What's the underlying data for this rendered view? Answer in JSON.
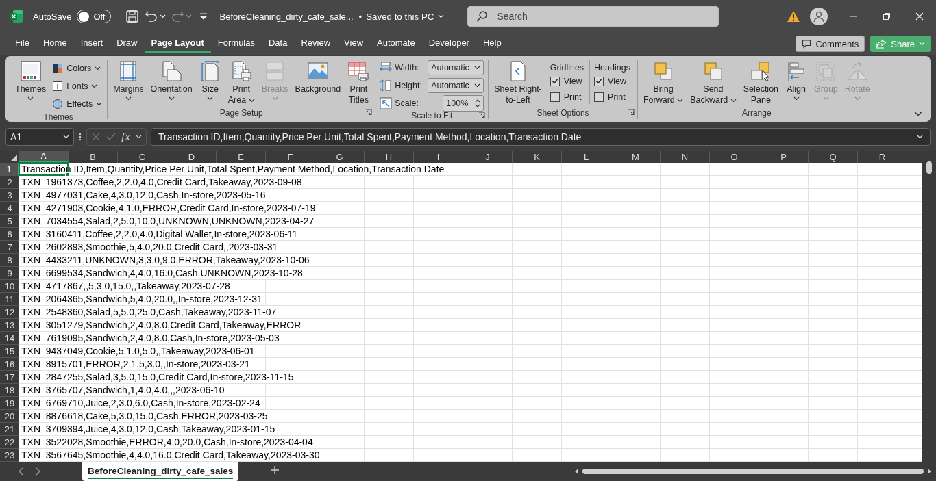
{
  "title_bar": {
    "quick_access": [
      {
        "kind": "save",
        "disabled": false
      },
      {
        "kind": "undo",
        "disabled": false
      },
      {
        "kind": "redo",
        "disabled": true
      },
      {
        "kind": "customize",
        "disabled": false
      }
    ],
    "autosave": {
      "label": "AutoSave",
      "on": false,
      "state_text": "Off"
    },
    "file_name": "BeforeCleaning_dirty_cafe_sale...",
    "separator": "•",
    "save_status": "Saved to this PC",
    "search": {
      "placeholder": "Search"
    }
  },
  "menu_tabs": [
    {
      "label": "File",
      "selected": false
    },
    {
      "label": "Home",
      "selected": false
    },
    {
      "label": "Insert",
      "selected": false
    },
    {
      "label": "Draw",
      "selected": false
    },
    {
      "label": "Page Layout",
      "selected": true
    },
    {
      "label": "Formulas",
      "selected": false
    },
    {
      "label": "Data",
      "selected": false
    },
    {
      "label": "Review",
      "selected": false
    },
    {
      "label": "View",
      "selected": false
    },
    {
      "label": "Automate",
      "selected": false
    },
    {
      "label": "Developer",
      "selected": false
    },
    {
      "label": "Help",
      "selected": false
    }
  ],
  "actions": [
    {
      "kind": "comments",
      "label": "Comments"
    },
    {
      "kind": "share",
      "label": "Share"
    }
  ],
  "ribbon": {
    "groups": [
      {
        "label": "Themes",
        "launcher": false,
        "items": [
          {
            "kind": "large",
            "lines": [
              "Themes"
            ],
            "dropdown": true,
            "disabled": false
          },
          {
            "kind": "stack",
            "items": [
              {
                "label": "Colors",
                "dropdown": true
              },
              {
                "label": "Fonts",
                "dropdown": true
              },
              {
                "label": "Effects",
                "dropdown": true
              }
            ]
          }
        ]
      },
      {
        "label": "Page Setup",
        "launcher": true,
        "items": [
          {
            "kind": "large",
            "lines": [
              "Margins"
            ],
            "dropdown": true,
            "disabled": false
          },
          {
            "kind": "large",
            "lines": [
              "Orientation"
            ],
            "dropdown": true,
            "disabled": false
          },
          {
            "kind": "large",
            "lines": [
              "Size"
            ],
            "dropdown": true,
            "disabled": false
          },
          {
            "kind": "large",
            "lines": [
              "Print",
              "Area"
            ],
            "dropdown": true,
            "disabled": false
          },
          {
            "kind": "large",
            "lines": [
              "Breaks"
            ],
            "dropdown": true,
            "disabled": true
          },
          {
            "kind": "large",
            "lines": [
              "Background"
            ],
            "dropdown": false,
            "disabled": false
          },
          {
            "kind": "large",
            "lines": [
              "Print",
              "Titles"
            ],
            "dropdown": false,
            "disabled": false
          }
        ]
      },
      {
        "label": "Scale to Fit",
        "launcher": true,
        "items": [
          {
            "kind": "fields",
            "items": [
              {
                "kind": "dropdown",
                "label": "Width:",
                "value": "Automatic"
              },
              {
                "kind": "dropdown",
                "label": "Height:",
                "value": "Automatic"
              },
              {
                "kind": "spinner",
                "label": "Scale:",
                "value": "100%"
              }
            ]
          }
        ]
      },
      {
        "label": "Sheet Options",
        "launcher": true,
        "items": [
          {
            "kind": "large",
            "lines": [
              "Sheet Right-",
              "to-Left"
            ],
            "dropdown": false,
            "disabled": false
          },
          {
            "kind": "checkgroup",
            "heading": "Gridlines",
            "items": [
              {
                "label": "View",
                "checked": true
              },
              {
                "label": "Print",
                "checked": false
              }
            ]
          },
          {
            "kind": "checkgroup",
            "heading": "Headings",
            "items": [
              {
                "label": "View",
                "checked": true
              },
              {
                "label": "Print",
                "checked": false
              }
            ]
          }
        ]
      },
      {
        "label": "Arrange",
        "launcher": false,
        "items": [
          {
            "kind": "large",
            "lines": [
              "Bring",
              "Forward"
            ],
            "dropdown": true,
            "disabled": false
          },
          {
            "kind": "large",
            "lines": [
              "Send",
              "Backward"
            ],
            "dropdown": true,
            "disabled": false
          },
          {
            "kind": "large",
            "lines": [
              "Selection",
              "Pane"
            ],
            "dropdown": false,
            "disabled": false
          },
          {
            "kind": "large",
            "lines": [
              "Align"
            ],
            "dropdown": true,
            "disabled": false
          },
          {
            "kind": "large",
            "lines": [
              "Group"
            ],
            "dropdown": true,
            "disabled": true
          },
          {
            "kind": "large",
            "lines": [
              "Rotate"
            ],
            "dropdown": true,
            "disabled": true
          }
        ]
      }
    ]
  },
  "formula_bar": {
    "name_box": "A1",
    "fx": "fx",
    "content": "Transaction ID,Item,Quantity,Price Per Unit,Total Spent,Payment Method,Location,Transaction Date"
  },
  "sheet": {
    "columns": [
      {
        "label": "A",
        "selected": true
      },
      {
        "label": "B",
        "selected": false
      },
      {
        "label": "C",
        "selected": false
      },
      {
        "label": "D",
        "selected": false
      },
      {
        "label": "E",
        "selected": false
      },
      {
        "label": "F",
        "selected": false
      },
      {
        "label": "G",
        "selected": false
      },
      {
        "label": "H",
        "selected": false
      },
      {
        "label": "I",
        "selected": false
      },
      {
        "label": "J",
        "selected": false
      },
      {
        "label": "K",
        "selected": false
      },
      {
        "label": "L",
        "selected": false
      },
      {
        "label": "M",
        "selected": false
      },
      {
        "label": "N",
        "selected": false
      },
      {
        "label": "O",
        "selected": false
      },
      {
        "label": "P",
        "selected": false
      },
      {
        "label": "Q",
        "selected": false
      },
      {
        "label": "R",
        "selected": false
      }
    ],
    "rows": [
      {
        "number": "1",
        "text": "Transaction ID,Item,Quantity,Price Per Unit,Total Spent,Payment Method,Location,Transaction Date",
        "selected": true
      },
      {
        "number": "2",
        "text": "TXN_1961373,Coffee,2,2.0,4.0,Credit Card,Takeaway,2023-09-08",
        "selected": false
      },
      {
        "number": "3",
        "text": "TXN_4977031,Cake,4,3.0,12.0,Cash,In-store,2023-05-16",
        "selected": false
      },
      {
        "number": "4",
        "text": "TXN_4271903,Cookie,4,1.0,ERROR,Credit Card,In-store,2023-07-19",
        "selected": false
      },
      {
        "number": "5",
        "text": "TXN_7034554,Salad,2,5.0,10.0,UNKNOWN,UNKNOWN,2023-04-27",
        "selected": false
      },
      {
        "number": "6",
        "text": "TXN_3160411,Coffee,2,2.0,4.0,Digital Wallet,In-store,2023-06-11",
        "selected": false
      },
      {
        "number": "7",
        "text": "TXN_2602893,Smoothie,5,4.0,20.0,Credit Card,,2023-03-31",
        "selected": false
      },
      {
        "number": "8",
        "text": "TXN_4433211,UNKNOWN,3,3.0,9.0,ERROR,Takeaway,2023-10-06",
        "selected": false
      },
      {
        "number": "9",
        "text": "TXN_6699534,Sandwich,4,4.0,16.0,Cash,UNKNOWN,2023-10-28",
        "selected": false
      },
      {
        "number": "10",
        "text": "TXN_4717867,,5,3.0,15.0,,Takeaway,2023-07-28",
        "selected": false
      },
      {
        "number": "11",
        "text": "TXN_2064365,Sandwich,5,4.0,20.0,,In-store,2023-12-31",
        "selected": false
      },
      {
        "number": "12",
        "text": "TXN_2548360,Salad,5,5.0,25.0,Cash,Takeaway,2023-11-07",
        "selected": false
      },
      {
        "number": "13",
        "text": "TXN_3051279,Sandwich,2,4.0,8.0,Credit Card,Takeaway,ERROR",
        "selected": false
      },
      {
        "number": "14",
        "text": "TXN_7619095,Sandwich,2,4.0,8.0,Cash,In-store,2023-05-03",
        "selected": false
      },
      {
        "number": "15",
        "text": "TXN_9437049,Cookie,5,1.0,5.0,,Takeaway,2023-06-01",
        "selected": false
      },
      {
        "number": "16",
        "text": "TXN_8915701,ERROR,2,1.5,3.0,,In-store,2023-03-21",
        "selected": false
      },
      {
        "number": "17",
        "text": "TXN_2847255,Salad,3,5.0,15.0,Credit Card,In-store,2023-11-15",
        "selected": false
      },
      {
        "number": "18",
        "text": "TXN_3765707,Sandwich,1,4.0,4.0,,,2023-06-10",
        "selected": false
      },
      {
        "number": "19",
        "text": "TXN_6769710,Juice,2,3.0,6.0,Cash,In-store,2023-02-24",
        "selected": false
      },
      {
        "number": "20",
        "text": "TXN_8876618,Cake,5,3.0,15.0,Cash,ERROR,2023-03-25",
        "selected": false
      },
      {
        "number": "21",
        "text": "TXN_3709394,Juice,4,3.0,12.0,Cash,Takeaway,2023-01-15",
        "selected": false
      },
      {
        "number": "22",
        "text": "TXN_3522028,Smoothie,ERROR,4.0,20.0,Cash,In-store,2023-04-04",
        "selected": false
      },
      {
        "number": "23",
        "text": "TXN_3567645,Smoothie,4,4.0,16.0,Credit Card,Takeaway,2023-03-30",
        "selected": false
      }
    ]
  },
  "sheet_tabs": [
    {
      "label": "BeforeCleaning_dirty_cafe_sales",
      "selected": true
    }
  ]
}
